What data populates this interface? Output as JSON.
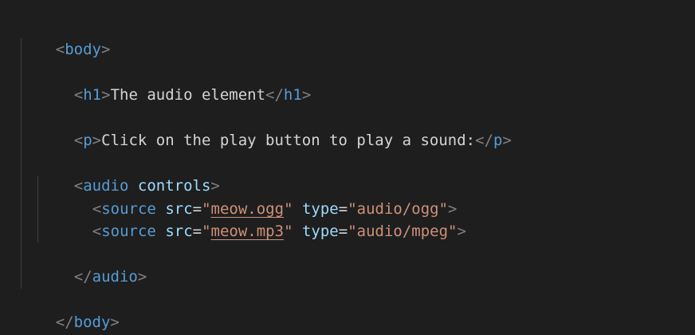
{
  "code": {
    "open_body_tag": "body",
    "h1": {
      "tag": "h1",
      "text": "The audio element"
    },
    "p": {
      "tag": "p",
      "text": "Click on the play button to play a sound:"
    },
    "audio": {
      "tag": "audio",
      "attribute": "controls"
    },
    "sources": [
      {
        "tag": "source",
        "src_attr": "src",
        "src_value": "meow.ogg",
        "type_attr": "type",
        "type_value": "audio/ogg"
      },
      {
        "tag": "source",
        "src_attr": "src",
        "src_value": "meow.mp3",
        "type_attr": "type",
        "type_value": "audio/mpeg"
      }
    ],
    "close_audio_tag": "audio",
    "close_body_tag": "body"
  },
  "colors": {
    "background": "#1e1e1e",
    "punctuation": "#808080",
    "tag": "#569cd6",
    "attribute": "#9cdcfe",
    "string": "#ce9178",
    "text": "#d4d4d4",
    "indent_guide": "#404040"
  }
}
